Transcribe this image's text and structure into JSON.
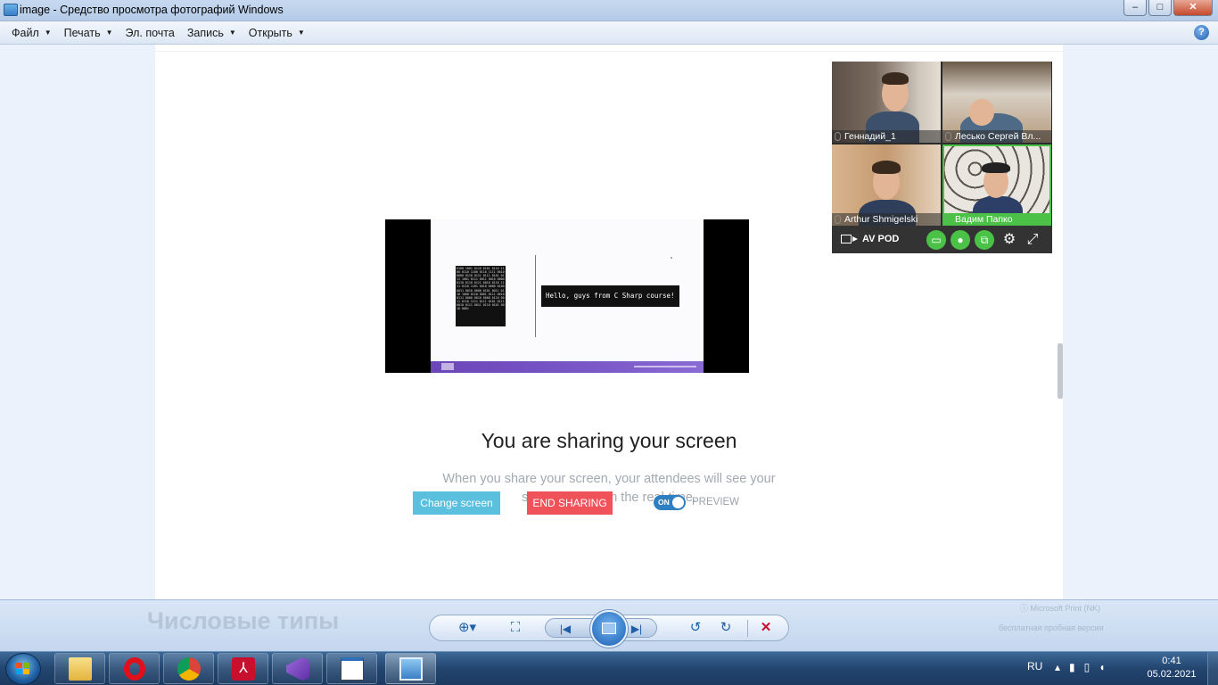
{
  "window": {
    "title": "image - Средство просмотра фотографий Windows",
    "minimize": "–",
    "maximize": "□",
    "close": "✕"
  },
  "menu": {
    "items": [
      {
        "label": "Файл",
        "has_dropdown": true
      },
      {
        "label": "Печать",
        "has_dropdown": true
      },
      {
        "label": "Эл. почта",
        "has_dropdown": false
      },
      {
        "label": "Запись",
        "has_dropdown": true
      },
      {
        "label": "Открыть",
        "has_dropdown": true
      }
    ],
    "help": "?"
  },
  "share": {
    "preview": {
      "binary_text": "0100 1001 0110 0101 0110 1100 0110 1100 0110 1111 0010 0000 0110 0111 0111 0101 0111 1001 0111 0011 0010 0000 0110 0110 0111 0010 0110 1111 0110 1101 0010 0000 0100 0011 0010 0000 0101 0011 0110 1000 0110 0001 0111 0010 0111 0000 0010 0000 0110 0011 0110 1111 0111 0101 0111 0010 0111 0011 0110 0101 0010 0001",
      "hello_text": "Hello, guys from C Sharp course!"
    },
    "heading": "You are sharing your screen",
    "description_line1": "When you share your screen, your attendees will see your",
    "description_line2": "shared screen in the real-time.",
    "change_screen": "Change screen",
    "end_sharing": "END SHARING",
    "toggle_state": "ON",
    "preview_label": "PREVIEW"
  },
  "video_panel": {
    "participants": [
      {
        "name": "Геннадий_1",
        "active": false
      },
      {
        "name": "Лесько Сергей Вл...",
        "active": false
      },
      {
        "name": "Arthur Shmigelski",
        "active": false
      },
      {
        "name": "Вадим Папко",
        "active": true
      }
    ],
    "room_label": "AV POD",
    "accent_color": "#4bc247"
  },
  "viewer_toolbar": {
    "background_title": "Числовые типы",
    "background_text1": "ⓘ Microsoft Print (NK)",
    "background_text2": "бесплатная пробная версия"
  },
  "taskbar": {
    "apps": [
      "explorer-icon",
      "opera-icon",
      "chrome-icon",
      "acrobat-icon",
      "visual-studio-icon",
      "notepad-icon",
      "photo-viewer-icon"
    ],
    "language": "RU",
    "time": "0:41",
    "date": "05.02.2021"
  }
}
